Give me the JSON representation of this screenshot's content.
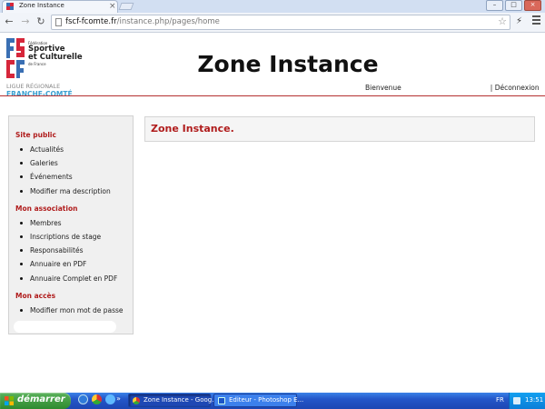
{
  "browser": {
    "tab_title": "Zone Instance",
    "url_host": "fscf-fcomte.fr",
    "url_path": "/instance.php/pages/home",
    "close_glyph": "×"
  },
  "header": {
    "title": "Zone Instance",
    "welcome": "Bienvenue",
    "logout": "| Déconnexion"
  },
  "logo": {
    "fed": "Fédération",
    "line1": "Sportive",
    "line2": "et Culturelle",
    "fr": "de France",
    "ligue": "LIGUE RÉGIONALE",
    "region": "FRANCHE-COMTÉ",
    "colors": {
      "blue": "#3a6fb3",
      "red": "#d6263a"
    }
  },
  "sidebar": {
    "sections": [
      {
        "title": "Site public",
        "items": [
          "Actualités",
          "Galeries",
          "Événements",
          "Modifier ma description"
        ]
      },
      {
        "title": "Mon association",
        "items": [
          "Membres",
          "Inscriptions de stage",
          "Responsabilités",
          "Annuaire en PDF",
          "Annuaire Complet en PDF"
        ]
      },
      {
        "title": "Mon accès",
        "items": [
          "Modifier mon mot de passe"
        ]
      }
    ]
  },
  "main": {
    "heading": "Zone Instance."
  },
  "taskbar": {
    "start": "démarrer",
    "tasks": [
      "Zone Instance - Goog...",
      "Editeur - Photoshop E..."
    ],
    "lang": "FR",
    "clock": "13:51"
  },
  "colors": {
    "accent": "#b01c1c",
    "header_rule": "#b43030",
    "sidebar_bg": "#f0f0f0"
  }
}
